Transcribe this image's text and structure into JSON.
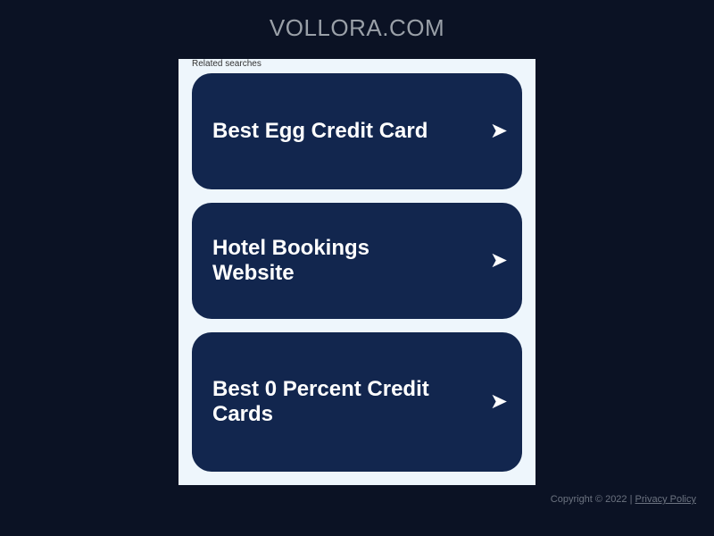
{
  "header": {
    "site_name": "VOLLORA.COM"
  },
  "related": {
    "label": "Related searches",
    "items": [
      {
        "label": "Best Egg Credit Card",
        "arrow": "➤",
        "icon": "arrow-right-icon"
      },
      {
        "label": "Hotel Bookings Website",
        "arrow": "➤",
        "icon": "arrow-right-icon"
      },
      {
        "label": "Best 0 Percent Credit Cards",
        "arrow": "➤",
        "icon": "arrow-right-icon"
      }
    ]
  },
  "footer": {
    "copyright": "Copyright © 2022 |",
    "privacy_link": "Privacy Policy"
  },
  "colors": {
    "background": "#0b1224",
    "panel": "#eef6fc",
    "card": "#12264e"
  }
}
